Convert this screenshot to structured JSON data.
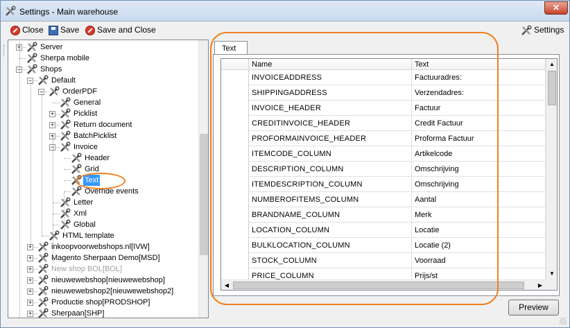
{
  "window": {
    "title": "Settings - Main warehouse",
    "close_glyph": "✕"
  },
  "toolbar": {
    "close_label": "Close",
    "save_label": "Save",
    "save_close_label": "Save and Close",
    "settings_label": "Settings"
  },
  "tree": {
    "nodes": [
      {
        "label": "Server",
        "expander": "+"
      },
      {
        "label": "Sherpa mobile",
        "expander": ""
      },
      {
        "label": "Shops",
        "expander": "−"
      },
      {
        "label": "Default",
        "expander": "−"
      },
      {
        "label": "OrderPDF",
        "expander": "−"
      },
      {
        "label": "General",
        "expander": ""
      },
      {
        "label": "Picklist",
        "expander": "+"
      },
      {
        "label": "Return document",
        "expander": "+"
      },
      {
        "label": "BatchPicklist",
        "expander": "+"
      },
      {
        "label": "Invoice",
        "expander": "−"
      },
      {
        "label": "Header",
        "expander": ""
      },
      {
        "label": "Grid",
        "expander": ""
      },
      {
        "label": "Text",
        "expander": "",
        "selected": true
      },
      {
        "label": "Override events",
        "expander": ""
      },
      {
        "label": "Letter",
        "expander": ""
      },
      {
        "label": "Xml",
        "expander": ""
      },
      {
        "label": "Global",
        "expander": ""
      },
      {
        "label": "HTML template",
        "expander": ""
      },
      {
        "label": "inkoopvoorwebshops.nl[IVW]",
        "expander": "+"
      },
      {
        "label": "Magento Sherpaan Demo[MSD]",
        "expander": "+"
      },
      {
        "label": "New shop BOL[BOL]",
        "expander": "+",
        "disabled": true
      },
      {
        "label": "nieuwewebshop[nieuwewebshop]",
        "expander": "+"
      },
      {
        "label": "nieuwewebshop2[nieuwewebshop2]",
        "expander": "+"
      },
      {
        "label": "Productie shop[PRODSHOP]",
        "expander": "+"
      },
      {
        "label": "Sherpaan[SHP]",
        "expander": "+"
      }
    ]
  },
  "tab": {
    "label": "Text"
  },
  "grid": {
    "columns": [
      "Name",
      "Text"
    ],
    "rows": [
      {
        "name": "INVOICEADDRESS",
        "text": "Factuuradres:"
      },
      {
        "name": "SHIPPINGADDRESS",
        "text": "Verzendadres:"
      },
      {
        "name": "INVOICE_HEADER",
        "text": "Factuur"
      },
      {
        "name": "CREDITINVOICE_HEADER",
        "text": "Credit Factuur"
      },
      {
        "name": "PROFORMAINVOICE_HEADER",
        "text": "Proforma Factuur"
      },
      {
        "name": "ITEMCODE_COLUMN",
        "text": "Artikelcode"
      },
      {
        "name": "DESCRIPTION_COLUMN",
        "text": "Omschrijving"
      },
      {
        "name": "ITEMDESCRIPTION_COLUMN",
        "text": "Omschrijving"
      },
      {
        "name": "NUMBEROFITEMS_COLUMN",
        "text": "Aantal"
      },
      {
        "name": "BRANDNAME_COLUMN",
        "text": "Merk"
      },
      {
        "name": "LOCATION_COLUMN",
        "text": "Locatie"
      },
      {
        "name": "BULKLOCATION_COLUMN",
        "text": "Locatie (2)"
      },
      {
        "name": "STOCK_COLUMN",
        "text": "Voorraad"
      },
      {
        "name": "PRICE_COLUMN",
        "text": "Prijs/st"
      }
    ]
  },
  "preview_label": "Preview",
  "colors": {
    "annotation": "#f08020",
    "selection": "#3399ff"
  }
}
